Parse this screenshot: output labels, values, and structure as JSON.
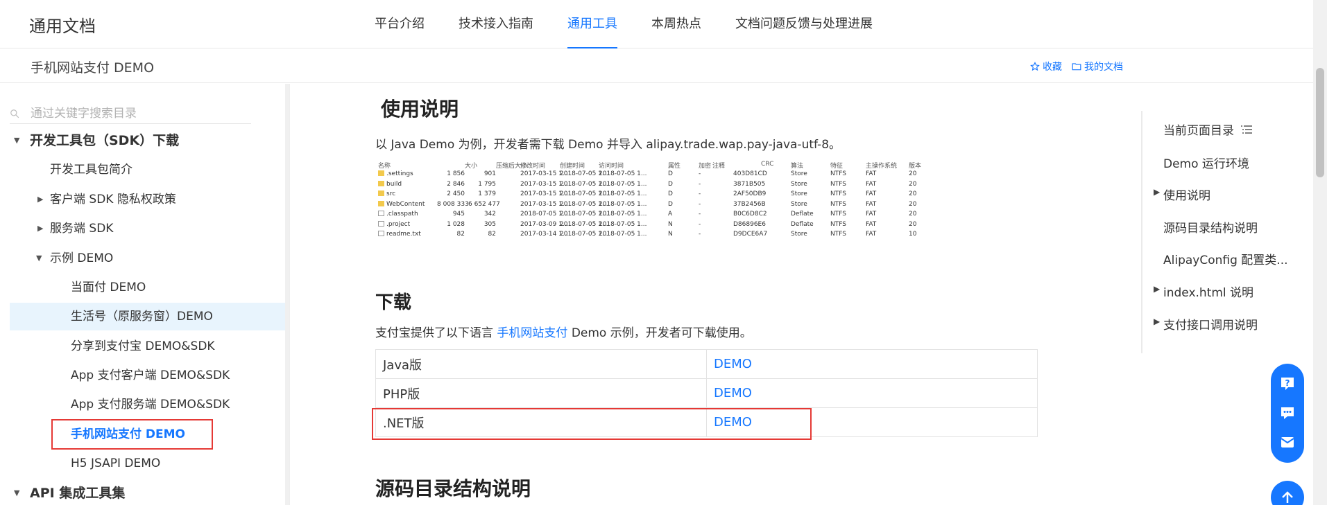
{
  "topnav": {
    "brand": "通用文档",
    "tabs": [
      {
        "label": "平台介绍"
      },
      {
        "label": "技术接入指南"
      },
      {
        "label": "通用工具"
      },
      {
        "label": "本周热点"
      },
      {
        "label": "文档问题反馈与处理进展"
      }
    ],
    "active_tab": "通用工具"
  },
  "subbar": {
    "title": "手机网站支付 DEMO",
    "favorite_label": "收藏",
    "mydocs_label": "我的文档"
  },
  "sidebar": {
    "search_placeholder": "通过关键字搜索目录",
    "items": [
      {
        "label": "开发工具包（SDK）下载"
      },
      {
        "label": "开发工具包简介"
      },
      {
        "label": "客户端 SDK 隐私权政策"
      },
      {
        "label": "服务端 SDK"
      },
      {
        "label": "示例 DEMO"
      },
      {
        "label": "当面付 DEMO"
      },
      {
        "label": "生活号（原服务窗）DEMO"
      },
      {
        "label": "分享到支付宝 DEMO&SDK"
      },
      {
        "label": "App 支付客户端 DEMO&SDK"
      },
      {
        "label": "App 支付服务端 DEMO&SDK"
      },
      {
        "label": "手机网站支付 DEMO"
      },
      {
        "label": "H5 JSAPI DEMO"
      },
      {
        "label": "API 集成工具集"
      }
    ]
  },
  "main": {
    "usage_heading": "使用说明",
    "usage_text": "以 Java Demo 为例，开发者需下载 Demo 并导入 alipay.trade.wap.pay-java-utf-8。",
    "file_table": {
      "headers": [
        "名称",
        "大小",
        "压缩后大小",
        "修改时间",
        "创建时间",
        "访问时间",
        "属性",
        "加密",
        "注释",
        "CRC",
        "算法",
        "特征",
        "主操作系统",
        "版本"
      ],
      "rows": [
        [
          ".settings",
          "1 856",
          "901",
          "2017-03-15 1...",
          "2018-07-05 1...",
          "2018-07-05 1...",
          "D",
          "-",
          "",
          "403D81CD",
          "Store",
          "NTFS",
          "FAT",
          "20"
        ],
        [
          "build",
          "2 846",
          "1 795",
          "2017-03-15 1...",
          "2018-07-05 1...",
          "2018-07-05 1...",
          "D",
          "-",
          "",
          "3871B505",
          "Store",
          "NTFS",
          "FAT",
          "20"
        ],
        [
          "src",
          "2 450",
          "1 379",
          "2017-03-15 1...",
          "2018-07-05 1...",
          "2018-07-05 1...",
          "D",
          "-",
          "",
          "2AF50DB9",
          "Store",
          "NTFS",
          "FAT",
          "20"
        ],
        [
          "WebContent",
          "8 008 333",
          "6 652 477",
          "2017-03-15 1...",
          "2018-07-05 1...",
          "2018-07-05 1...",
          "D",
          "-",
          "",
          "37B2456B",
          "Store",
          "NTFS",
          "FAT",
          "20"
        ],
        [
          ".classpath",
          "945",
          "342",
          "2018-07-05 1...",
          "2018-07-05 1...",
          "2018-07-05 1...",
          "A",
          "-",
          "",
          "B0C6D8C2",
          "Deflate",
          "NTFS",
          "FAT",
          "20"
        ],
        [
          ".project",
          "1 028",
          "305",
          "2017-03-09 1...",
          "2018-07-05 1...",
          "2018-07-05 1...",
          "N",
          "-",
          "",
          "D86896E6",
          "Deflate",
          "NTFS",
          "FAT",
          "20"
        ],
        [
          "readme.txt",
          "82",
          "82",
          "2017-03-14 1...",
          "2018-07-05 1...",
          "2018-07-05 1...",
          "N",
          "-",
          "",
          "D9DCE6A7",
          "Store",
          "NTFS",
          "FAT",
          "10"
        ]
      ]
    },
    "download_heading": "下载",
    "download_text_prefix": "支付宝提供了以下语言",
    "download_text_link": "手机网站支付",
    "download_text_suffix": "Demo 示例，开发者可下载使用。",
    "download_rows": [
      {
        "lang": "Java版",
        "link": "DEMO"
      },
      {
        "lang": "PHP版",
        "link": "DEMO"
      },
      {
        "lang": ".NET版",
        "link": "DEMO"
      }
    ],
    "source_heading": "源码目录结构说明"
  },
  "toc": {
    "title": "当前页面目录",
    "items": [
      {
        "label": "Demo 运行环境"
      },
      {
        "label": "使用说明"
      },
      {
        "label": "源码目录结构说明"
      },
      {
        "label": "AlipayConfig  配置类..."
      },
      {
        "label": "index.html 说明"
      },
      {
        "label": "支付接口调用说明"
      }
    ]
  },
  "colors": {
    "accent": "#1677ff",
    "highlight_box": "#e53935",
    "sidebar_highlight": "#e8f4fd"
  }
}
